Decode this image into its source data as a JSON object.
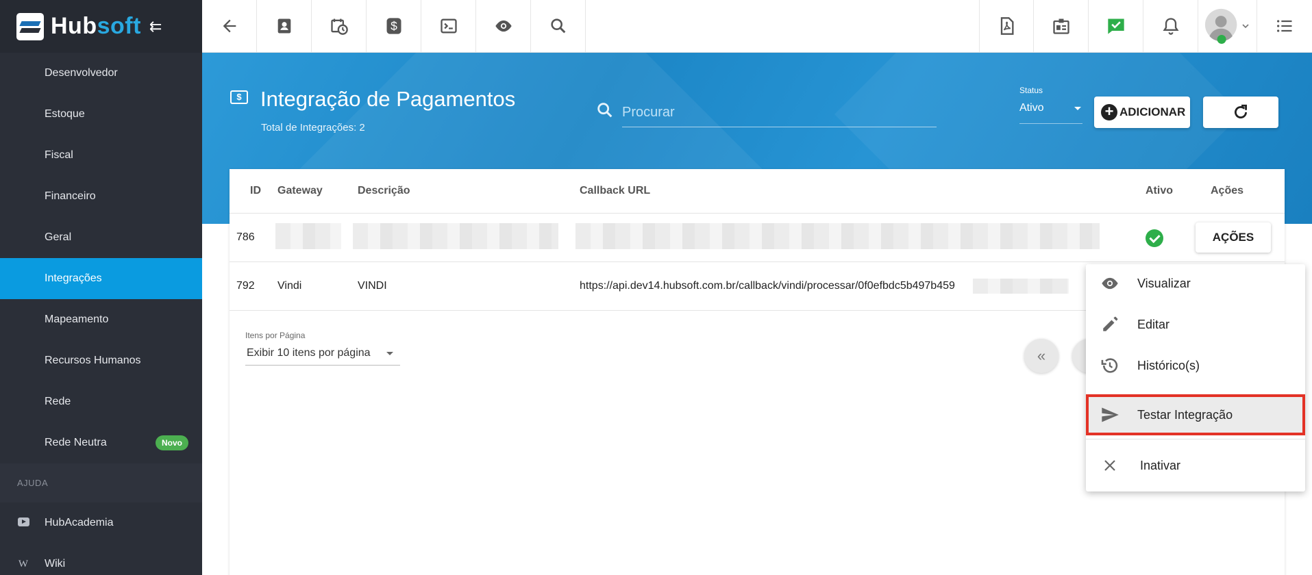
{
  "brand": {
    "hub": "Hub",
    "soft": "soft"
  },
  "sidebar": {
    "items": [
      {
        "label": "Desenvolvedor"
      },
      {
        "label": "Estoque"
      },
      {
        "label": "Fiscal"
      },
      {
        "label": "Financeiro"
      },
      {
        "label": "Geral"
      },
      {
        "label": "Integrações",
        "active": true
      },
      {
        "label": "Mapeamento"
      },
      {
        "label": "Recursos Humanos"
      },
      {
        "label": "Rede"
      },
      {
        "label": "Rede Neutra",
        "badge": "Novo"
      }
    ],
    "section": "AJUDA",
    "help": [
      {
        "label": "HubAcademia",
        "icon": "youtube-icon"
      },
      {
        "label": "Wiki",
        "icon": "wikipedia-icon",
        "glyph": "W"
      }
    ]
  },
  "topbar": {
    "icons": [
      "back-arrow-icon",
      "contact-card-icon",
      "calendar-clock-icon",
      "dollar-icon",
      "terminal-icon",
      "eye-icon",
      "search-icon",
      "pdf-icon",
      "badge-icon",
      "chat-check-icon",
      "bell-icon",
      "avatar",
      "list-icon"
    ]
  },
  "header": {
    "title": "Integração de Pagamentos",
    "subtitle": "Total de Integrações: 2",
    "icon_glyph": "$",
    "search_placeholder": "Procurar",
    "status_label": "Status",
    "status_value": "Ativo",
    "add_label": "ADICIONAR"
  },
  "table": {
    "columns": [
      "ID",
      "Gateway",
      "Descrição",
      "Callback URL",
      "Ativo",
      "Ações"
    ],
    "rows": [
      {
        "id": "786",
        "gateway": "",
        "descricao": "",
        "callback": "",
        "ativo": true,
        "acoes": "AÇÕES"
      },
      {
        "id": "792",
        "gateway": "Vindi",
        "descricao": "VINDI",
        "callback": "https://api.dev14.hubsoft.com.br/callback/vindi/processar/0f0efbdc5b497b459"
      }
    ]
  },
  "pagination": {
    "per_page_label": "Itens por Página",
    "per_page_value": "Exibir 10 itens por página",
    "first_glyph": "«"
  },
  "action_menu": {
    "items": [
      {
        "label": "Visualizar",
        "icon": "eye-icon"
      },
      {
        "label": "Editar",
        "icon": "pencil-icon"
      },
      {
        "label": "Histórico(s)",
        "icon": "history-icon"
      },
      {
        "label": "Testar Integração",
        "icon": "send-icon",
        "highlighted": true
      },
      {
        "label": "Inativar",
        "icon": "close-icon"
      }
    ]
  },
  "colors": {
    "sidebar_bg": "#2b2f38",
    "sidebar_active": "#0a9be0",
    "hero_blue": "#1c86c6",
    "badge_green": "#4caf50",
    "check_green": "#2eae4a",
    "highlight_red": "#e33226"
  }
}
